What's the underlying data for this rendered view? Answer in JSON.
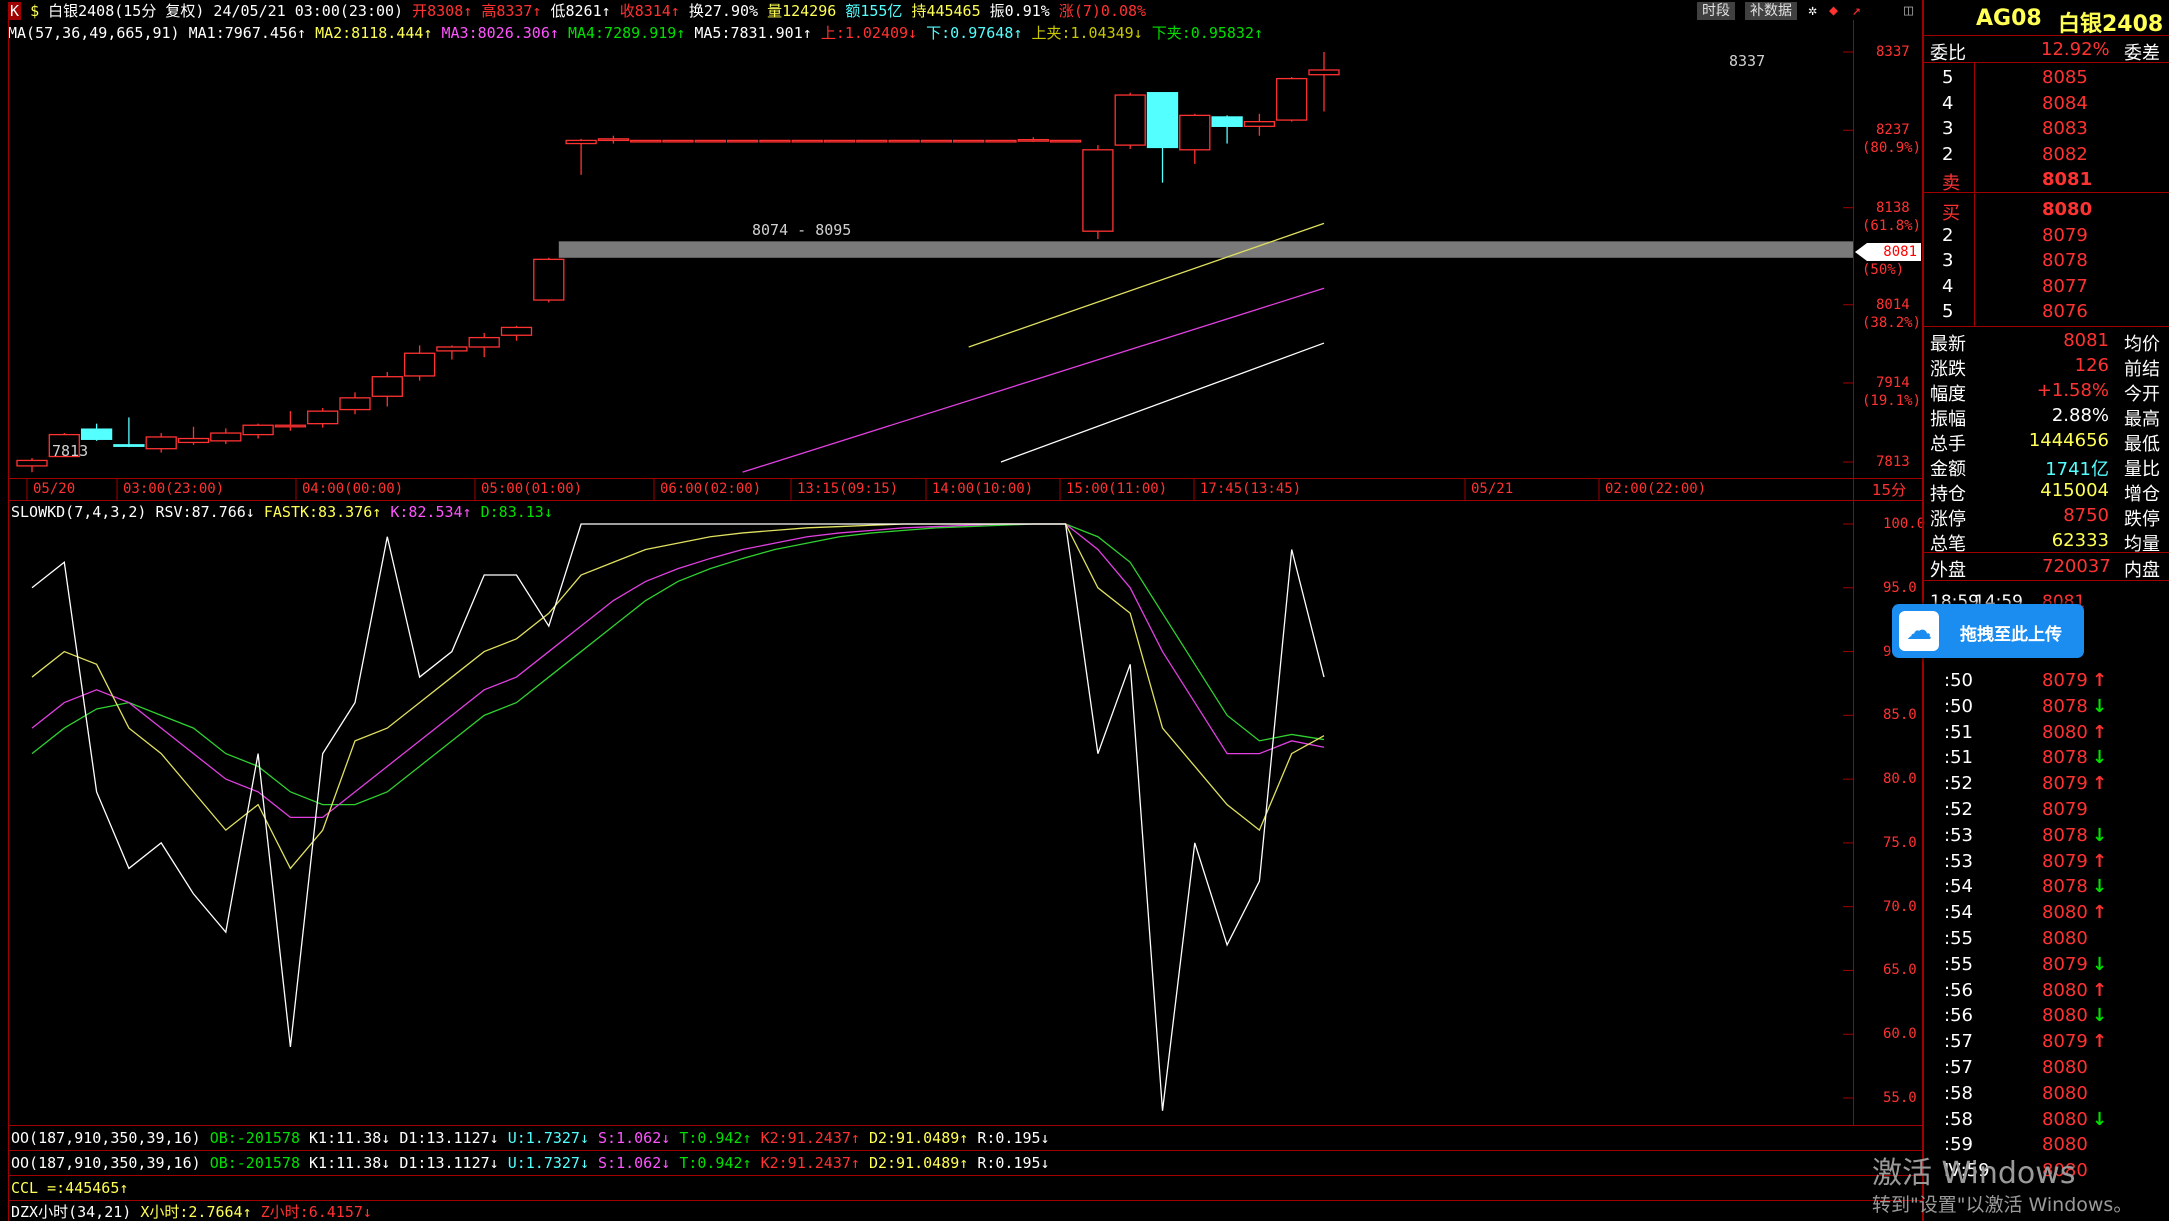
{
  "header": {
    "icons_k": "K",
    "icons_dollar": "$",
    "symbol": "白银2408(15分 复权) 24/05/21 03:00(23:00)",
    "open": "开8308↑",
    "high": "高8337↑",
    "low": "低8261↑",
    "close": "收8314↑",
    "turnover": "换27.90%",
    "volume": "量124296",
    "amount": "额155亿",
    "hold": "持445465",
    "amplitude": "振0.91%",
    "change": "涨(7)0.08%",
    "btn_period": "时段",
    "btn_supplement": "补数据"
  },
  "ma_line": {
    "params": "MA(57,36,49,665,91)",
    "ma1": "MA1:7967.456↑",
    "ma2": "MA2:8118.444↑",
    "ma3": "MA3:8026.306↑",
    "ma4": "MA4:7289.919↑",
    "ma5": "MA5:7831.901↑",
    "up": "上:1.02409↓",
    "down": "下:0.97648↑",
    "upper_band": "上夹:1.04349↓",
    "lower_band": "下夹:0.95832↑"
  },
  "price_axis": [
    {
      "label": "8337",
      "pct": ""
    },
    {
      "label": "8237",
      "pct": "(80.9%)"
    },
    {
      "label": "8138",
      "pct": "(61.8%)"
    },
    {
      "label": "8081",
      "pct": "(50%)"
    },
    {
      "label": "8014",
      "pct": "(38.2%)"
    },
    {
      "label": "7914",
      "pct": "(19.1%)"
    },
    {
      "label": "7813",
      "pct": ""
    }
  ],
  "current_price_tag": "8081",
  "annotations": {
    "high_label": "8337",
    "low_label": "7813",
    "band_label": "8074 - 8095"
  },
  "time_axis": [
    "05/20",
    "03:00(23:00)",
    "04:00(00:00)",
    "05:00(01:00)",
    "06:00(02:00)",
    "13:15(09:15)",
    "14:00(10:00)",
    "15:00(11:00)",
    "17:45(13:45)",
    "05/21",
    "02:00(22:00)"
  ],
  "period_label": "15分",
  "slowkd": {
    "params": "SLOWKD(7,4,3,2)",
    "rsv": "RSV:87.766↓",
    "fastk": "FASTK:83.376↑",
    "k": "K:82.534↑",
    "d": "D:83.13↓"
  },
  "kd_axis": [
    "100.0",
    "95.0",
    "90.0",
    "85.0",
    "80.0",
    "75.0",
    "70.0",
    "65.0",
    "60.0",
    "55.0"
  ],
  "indicator_rows": [
    {
      "name": "OO(187,910,350,39,16)",
      "ob": "OB:-201578",
      "k1": "K1:11.38↓",
      "d1": "D1:13.1127↓",
      "u": "U:1.7327↓",
      "s": "S:1.062↓",
      "t": "T:0.942↑",
      "k2": "K2:91.2437↑",
      "d2": "D2:91.0489↑",
      "r": "R:0.195↓"
    },
    {
      "name": "OO(187,910,350,39,16)",
      "ob": "OB:-201578",
      "k1": "K1:11.38↓",
      "d1": "D1:13.1127↓",
      "u": "U:1.7327↓",
      "s": "S:1.062↓",
      "t": "T:0.942↑",
      "k2": "K2:91.2437↑",
      "d2": "D2:91.0489↑",
      "r": "R:0.195↓"
    }
  ],
  "ccl": "CCL =:445465↑",
  "dzx": {
    "name": "DZX小时(34,21)",
    "x": "X小时:2.7664↑",
    "z": "Z小时:6.4157↓"
  },
  "right_panel": {
    "code": "AG08",
    "name": "白银2408",
    "ratio_label": "委比",
    "ratio_value": "12.92%",
    "diff_label": "委差",
    "asks": [
      {
        "level": "5",
        "price": "8085"
      },
      {
        "level": "4",
        "price": "8084"
      },
      {
        "level": "3",
        "price": "8083"
      },
      {
        "level": "2",
        "price": "8082"
      },
      {
        "level": "卖",
        "price": "8081"
      }
    ],
    "bids": [
      {
        "level": "买",
        "price": "8080"
      },
      {
        "level": "2",
        "price": "8079"
      },
      {
        "level": "3",
        "price": "8078"
      },
      {
        "level": "4",
        "price": "8077"
      },
      {
        "level": "5",
        "price": "8076"
      }
    ],
    "stats": [
      {
        "l": "最新",
        "v": "8081",
        "r": "均价",
        "c": "red"
      },
      {
        "l": "涨跌",
        "v": "126",
        "r": "前结",
        "c": "red"
      },
      {
        "l": "幅度",
        "v": "+1.58%",
        "r": "今开",
        "c": "red"
      },
      {
        "l": "振幅",
        "v": "2.88%",
        "r": "最高",
        "c": "white"
      },
      {
        "l": "总手",
        "v": "1444656",
        "r": "最低",
        "c": "yel"
      },
      {
        "l": "金额",
        "v": "1741亿",
        "r": "量比",
        "c": "cyan"
      },
      {
        "l": "持仓",
        "v": "415004",
        "r": "增仓",
        "c": "yel"
      },
      {
        "l": "涨停",
        "v": "8750",
        "r": "跌停",
        "c": "red"
      },
      {
        "l": "总笔",
        "v": "62333",
        "r": "均量",
        "c": "yel"
      }
    ],
    "outer_label": "外盘",
    "outer_value": "720037",
    "inner_label": "内盘",
    "tick_first": {
      "time": "18:59",
      "sec": "14:59",
      "price": "8081"
    },
    "ticks": [
      {
        "t": ":50",
        "p": "8079",
        "d": "↑",
        "c": "red"
      },
      {
        "t": ":50",
        "p": "8078",
        "d": "↓",
        "c": "green"
      },
      {
        "t": ":51",
        "p": "8080",
        "d": "↑",
        "c": "red"
      },
      {
        "t": ":51",
        "p": "8078",
        "d": "↓",
        "c": "green"
      },
      {
        "t": ":52",
        "p": "8079",
        "d": "↑",
        "c": "red"
      },
      {
        "t": ":52",
        "p": "8079",
        "d": "",
        "c": "red"
      },
      {
        "t": ":53",
        "p": "8078",
        "d": "↓",
        "c": "green"
      },
      {
        "t": ":53",
        "p": "8079",
        "d": "↑",
        "c": "red"
      },
      {
        "t": ":54",
        "p": "8078",
        "d": "↓",
        "c": "green"
      },
      {
        "t": ":54",
        "p": "8080",
        "d": "↑",
        "c": "red"
      },
      {
        "t": ":55",
        "p": "8080",
        "d": "",
        "c": "red"
      },
      {
        "t": ":55",
        "p": "8079",
        "d": "↓",
        "c": "green"
      },
      {
        "t": ":56",
        "p": "8080",
        "d": "↑",
        "c": "red"
      },
      {
        "t": ":56",
        "p": "8080",
        "d": "↓",
        "c": "green"
      },
      {
        "t": ":57",
        "p": "8079",
        "d": "↑",
        "c": "red"
      },
      {
        "t": ":57",
        "p": "8080",
        "d": "",
        "c": "red"
      },
      {
        "t": ":58",
        "p": "8080",
        "d": "",
        "c": "red"
      },
      {
        "t": ":58",
        "p": "8080",
        "d": "↓",
        "c": "green"
      },
      {
        "t": ":59",
        "p": "8080",
        "d": "",
        "c": "red"
      },
      {
        "t": "Ⅳ:59",
        "p": "8080",
        "d": "",
        "c": "red"
      }
    ]
  },
  "upload_button": "拖拽至此上传",
  "watermark": {
    "line1": "激活 Windows",
    "line2": "转到\"设置\"以激活 Windows。"
  },
  "chart_data": {
    "type": "candlestick",
    "title": "白银2408(15分 复权)",
    "price_range": [
      7813,
      8337
    ],
    "candles": [
      {
        "o": 7808,
        "h": 7818,
        "l": 7800,
        "c": 7815
      },
      {
        "o": 7820,
        "h": 7850,
        "l": 7820,
        "c": 7848
      },
      {
        "o": 7855,
        "h": 7862,
        "l": 7840,
        "c": 7842
      },
      {
        "o": 7835,
        "h": 7870,
        "l": 7832,
        "c": 7834
      },
      {
        "o": 7830,
        "h": 7850,
        "l": 7825,
        "c": 7845
      },
      {
        "o": 7838,
        "h": 7858,
        "l": 7835,
        "c": 7843
      },
      {
        "o": 7840,
        "h": 7856,
        "l": 7836,
        "c": 7850
      },
      {
        "o": 7848,
        "h": 7862,
        "l": 7843,
        "c": 7860
      },
      {
        "o": 7858,
        "h": 7878,
        "l": 7853,
        "c": 7860
      },
      {
        "o": 7862,
        "h": 7882,
        "l": 7857,
        "c": 7878
      },
      {
        "o": 7880,
        "h": 7902,
        "l": 7874,
        "c": 7895
      },
      {
        "o": 7897,
        "h": 7928,
        "l": 7884,
        "c": 7922
      },
      {
        "o": 7923,
        "h": 7962,
        "l": 7917,
        "c": 7952
      },
      {
        "o": 7955,
        "h": 7962,
        "l": 7944,
        "c": 7960
      },
      {
        "o": 7960,
        "h": 7978,
        "l": 7947,
        "c": 7972
      },
      {
        "o": 7975,
        "h": 7987,
        "l": 7968,
        "c": 7985
      },
      {
        "o": 8020,
        "h": 8074,
        "l": 8017,
        "c": 8072
      },
      {
        "o": 8220,
        "h": 8226,
        "l": 8180,
        "c": 8224
      },
      {
        "o": 8224,
        "h": 8230,
        "l": 8220,
        "c": 8226
      },
      {
        "o": 8224,
        "h": 8224,
        "l": 8224,
        "c": 8224
      },
      {
        "o": 8224,
        "h": 8224,
        "l": 8224,
        "c": 8224
      },
      {
        "o": 8224,
        "h": 8224,
        "l": 8224,
        "c": 8224
      },
      {
        "o": 8224,
        "h": 8224,
        "l": 8224,
        "c": 8224
      },
      {
        "o": 8224,
        "h": 8224,
        "l": 8224,
        "c": 8224
      },
      {
        "o": 8224,
        "h": 8224,
        "l": 8224,
        "c": 8224
      },
      {
        "o": 8224,
        "h": 8224,
        "l": 8224,
        "c": 8224
      },
      {
        "o": 8224,
        "h": 8224,
        "l": 8224,
        "c": 8224
      },
      {
        "o": 8224,
        "h": 8224,
        "l": 8224,
        "c": 8224
      },
      {
        "o": 8224,
        "h": 8224,
        "l": 8224,
        "c": 8224
      },
      {
        "o": 8224,
        "h": 8224,
        "l": 8224,
        "c": 8224
      },
      {
        "o": 8224,
        "h": 8224,
        "l": 8224,
        "c": 8224
      },
      {
        "o": 8224,
        "h": 8228,
        "l": 8222,
        "c": 8225
      },
      {
        "o": 8224,
        "h": 8224,
        "l": 8224,
        "c": 8224
      },
      {
        "o": 8108,
        "h": 8218,
        "l": 8098,
        "c": 8212
      },
      {
        "o": 8218,
        "h": 8285,
        "l": 8213,
        "c": 8282
      },
      {
        "o": 8285,
        "h": 8285,
        "l": 8170,
        "c": 8215
      },
      {
        "o": 8212,
        "h": 8258,
        "l": 8194,
        "c": 8256
      },
      {
        "o": 8254,
        "h": 8256,
        "l": 8220,
        "c": 8242
      },
      {
        "o": 8242,
        "h": 8258,
        "l": 8230,
        "c": 8248
      },
      {
        "o": 8250,
        "h": 8305,
        "l": 8248,
        "c": 8303
      },
      {
        "o": 8308,
        "h": 8337,
        "l": 8261,
        "c": 8314
      }
    ],
    "ma1": [
      [
        29,
        7960
      ],
      [
        40,
        8118
      ]
    ],
    "ma2": [
      [
        22,
        7800
      ],
      [
        40,
        8035
      ]
    ],
    "ma3": [
      [
        30,
        7813
      ],
      [
        40,
        7965
      ]
    ],
    "support_band": [
      8074,
      8095
    ],
    "slowkd": {
      "range": [
        55,
        100
      ],
      "rsv": [
        95,
        97,
        79,
        73,
        75,
        71,
        68,
        82,
        59,
        82,
        86,
        99,
        88,
        90,
        96,
        96,
        92,
        100,
        100,
        100,
        100,
        100,
        100,
        100,
        100,
        100,
        100,
        100,
        100,
        100,
        100,
        100,
        100,
        82,
        89,
        54,
        75,
        67,
        72,
        98,
        88
      ],
      "fastk": [
        88,
        90,
        89,
        84,
        82,
        79,
        76,
        78,
        73,
        76,
        83,
        84,
        86,
        88,
        90,
        91,
        93,
        96,
        97,
        98,
        98.5,
        99,
        99.3,
        99.5,
        99.7,
        99.8,
        99.9,
        100,
        100,
        100,
        100,
        100,
        100,
        95,
        93,
        84,
        81,
        78,
        76,
        82,
        83.4
      ],
      "k": [
        84,
        86,
        87,
        86,
        84,
        82,
        80,
        79,
        77,
        77,
        79,
        81,
        83,
        85,
        87,
        88,
        90,
        92,
        94,
        95.5,
        96.5,
        97.3,
        98,
        98.5,
        99,
        99.3,
        99.5,
        99.7,
        99.8,
        99.9,
        100,
        100,
        100,
        98,
        95,
        90,
        86,
        82,
        82,
        83,
        82.5
      ],
      "d": [
        82,
        84,
        85.5,
        86,
        85,
        84,
        82,
        81,
        79,
        78,
        78,
        79,
        81,
        83,
        85,
        86,
        88,
        90,
        92,
        94,
        95.5,
        96.5,
        97.3,
        98,
        98.5,
        99,
        99.3,
        99.5,
        99.7,
        99.8,
        99.9,
        100,
        100,
        99,
        97,
        93,
        89,
        85,
        83,
        83.5,
        83.1
      ]
    }
  }
}
